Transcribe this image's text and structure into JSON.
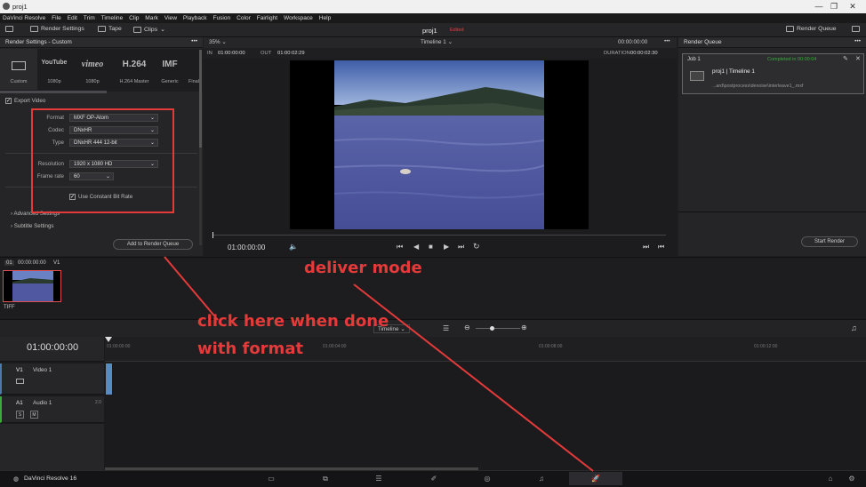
{
  "window": {
    "title": "proj1",
    "controls": [
      "—",
      "❐",
      "✕"
    ]
  },
  "menu": [
    "DaVinci Resolve",
    "File",
    "Edit",
    "Trim",
    "Timeline",
    "Clip",
    "Mark",
    "View",
    "Playback",
    "Fusion",
    "Color",
    "Fairlight",
    "Workspace",
    "Help"
  ],
  "toolbar": {
    "render_settings": "Render Settings",
    "tape": "Tape",
    "clips": "Clips",
    "project": "proj1",
    "edited": "Edited",
    "render_queue": "Render Queue"
  },
  "render_settings": {
    "header": "Render Settings - Custom",
    "presets": [
      {
        "label": "Custom",
        "logo": ""
      },
      {
        "label": "1080p",
        "logo": "YouTube"
      },
      {
        "label": "1080p",
        "logo": "vimeo"
      },
      {
        "label": "H.264 Master",
        "logo": "H.264"
      },
      {
        "label": "Generic",
        "logo": "IMF"
      },
      {
        "label": "Final",
        "logo": ""
      }
    ],
    "export_video": "Export Video",
    "format_label": "Format",
    "format_value": "MXF OP-Atom",
    "codec_label": "Codec",
    "codec_value": "DNxHR",
    "type_label": "Type",
    "type_value": "DNxHR 444 12-bit",
    "resolution_label": "Resolution",
    "resolution_value": "1920 x 1080 HD",
    "framerate_label": "Frame rate",
    "framerate_value": "60",
    "cbr_label": "Use Constant Bit Rate",
    "advanced": "Advanced Settings",
    "subtitle": "Subtitle Settings",
    "add_button": "Add to Render Queue"
  },
  "viewer": {
    "zoom": "35%",
    "timeline": "Timeline 1",
    "tc_top": "00:00:00:00",
    "in_label": "IN",
    "in_tc": "01:00:00:00",
    "out_label": "OUT",
    "out_tc": "01:00:02:29",
    "duration_label": "DURATION",
    "duration_tc": "00:00:02:30",
    "current_tc": "01:00:00:00"
  },
  "render_queue": {
    "header": "Render Queue",
    "job_label": "Job 1",
    "job_status": "Completed in 00:00:04",
    "job_title": "proj1 | Timeline 1",
    "job_path": "...ard\\postprocess\\denoise\\interleave1_.mxf",
    "start_button": "Start Render"
  },
  "clips": {
    "index": "01",
    "tc": "00:00:00:00",
    "track": "V1",
    "clip_label": "TIFF"
  },
  "timeline": {
    "timecode": "01:00:00:00",
    "selector": "Timeline",
    "ruler": [
      "01:00:00:00",
      "01:00:04:00",
      "01:00:08:00",
      "01:00:12:00"
    ],
    "v1_tag": "V1",
    "v1_name": "Video 1",
    "a1_tag": "A1",
    "a1_name": "Audio 1",
    "a1_level": "2.0",
    "s": "S",
    "m": "M"
  },
  "bottom": {
    "app": "DaVinci Resolve 16"
  },
  "annotations": {
    "deliver": "deliver mode",
    "click_line1": "click here when done",
    "click_line2": "with format"
  },
  "colors": {
    "annotation": "#e53a3a",
    "accent_edited": "#e04040",
    "status_green": "#3aaa3a"
  }
}
